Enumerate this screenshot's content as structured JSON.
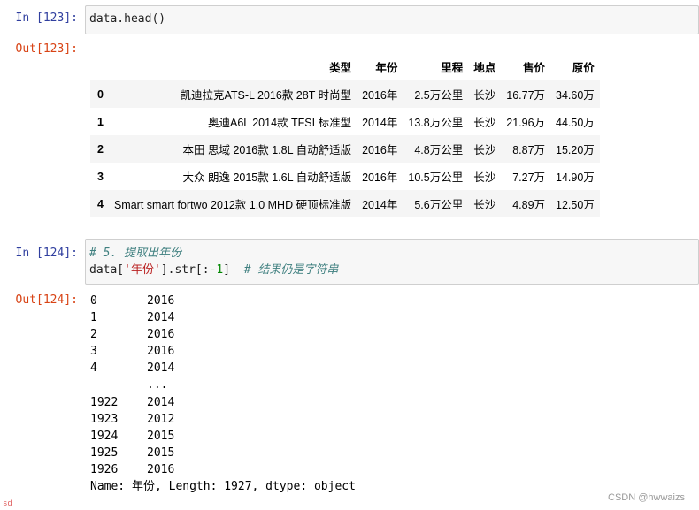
{
  "cell1": {
    "in_prompt": "In  [123]:",
    "code": "data.head()",
    "out_prompt": "Out[123]:"
  },
  "table": {
    "columns": [
      "",
      "类型",
      "年份",
      "里程",
      "地点",
      "售价",
      "原价"
    ],
    "rows": [
      {
        "index": "0",
        "type": "凯迪拉克ATS-L 2016款 28T 时尚型",
        "year": "2016年",
        "mileage": "2.5万公里",
        "location": "长沙",
        "price": "16.77万",
        "original": "34.60万"
      },
      {
        "index": "1",
        "type": "奥迪A6L 2014款 TFSI 标准型",
        "year": "2014年",
        "mileage": "13.8万公里",
        "location": "长沙",
        "price": "21.96万",
        "original": "44.50万"
      },
      {
        "index": "2",
        "type": "本田 思域 2016款 1.8L 自动舒适版",
        "year": "2016年",
        "mileage": "4.8万公里",
        "location": "长沙",
        "price": "8.87万",
        "original": "15.20万"
      },
      {
        "index": "3",
        "type": "大众 朗逸 2015款 1.6L 自动舒适版",
        "year": "2016年",
        "mileage": "10.5万公里",
        "location": "长沙",
        "price": "7.27万",
        "original": "14.90万"
      },
      {
        "index": "4",
        "type": "Smart smart fortwo 2012款 1.0 MHD 硬顶标准版",
        "year": "2014年",
        "mileage": "5.6万公里",
        "location": "长沙",
        "price": "4.89万",
        "original": "12.50万"
      }
    ]
  },
  "cell2": {
    "in_prompt": "In  [124]:",
    "comment1": "# 5. 提取出年份",
    "code_prefix": "data[",
    "code_string": "'年份'",
    "code_mid": "].str[:",
    "code_number": "-1",
    "code_close": "]",
    "code_spacing": "  ",
    "comment2": "# 结果仍是字符串",
    "out_prompt": "Out[124]:"
  },
  "series": {
    "head": [
      {
        "index": "0",
        "value": "2016"
      },
      {
        "index": "1",
        "value": "2014"
      },
      {
        "index": "2",
        "value": "2016"
      },
      {
        "index": "3",
        "value": "2016"
      },
      {
        "index": "4",
        "value": "2014"
      }
    ],
    "ellipsis": "...",
    "tail": [
      {
        "index": "1922",
        "value": "2014"
      },
      {
        "index": "1923",
        "value": "2012"
      },
      {
        "index": "1924",
        "value": "2015"
      },
      {
        "index": "1925",
        "value": "2015"
      },
      {
        "index": "1926",
        "value": "2016"
      }
    ],
    "footer": "Name: 年份, Length: 1927, dtype: object"
  },
  "watermark": "CSDN @hwwaizs",
  "corner_mark": "sd"
}
